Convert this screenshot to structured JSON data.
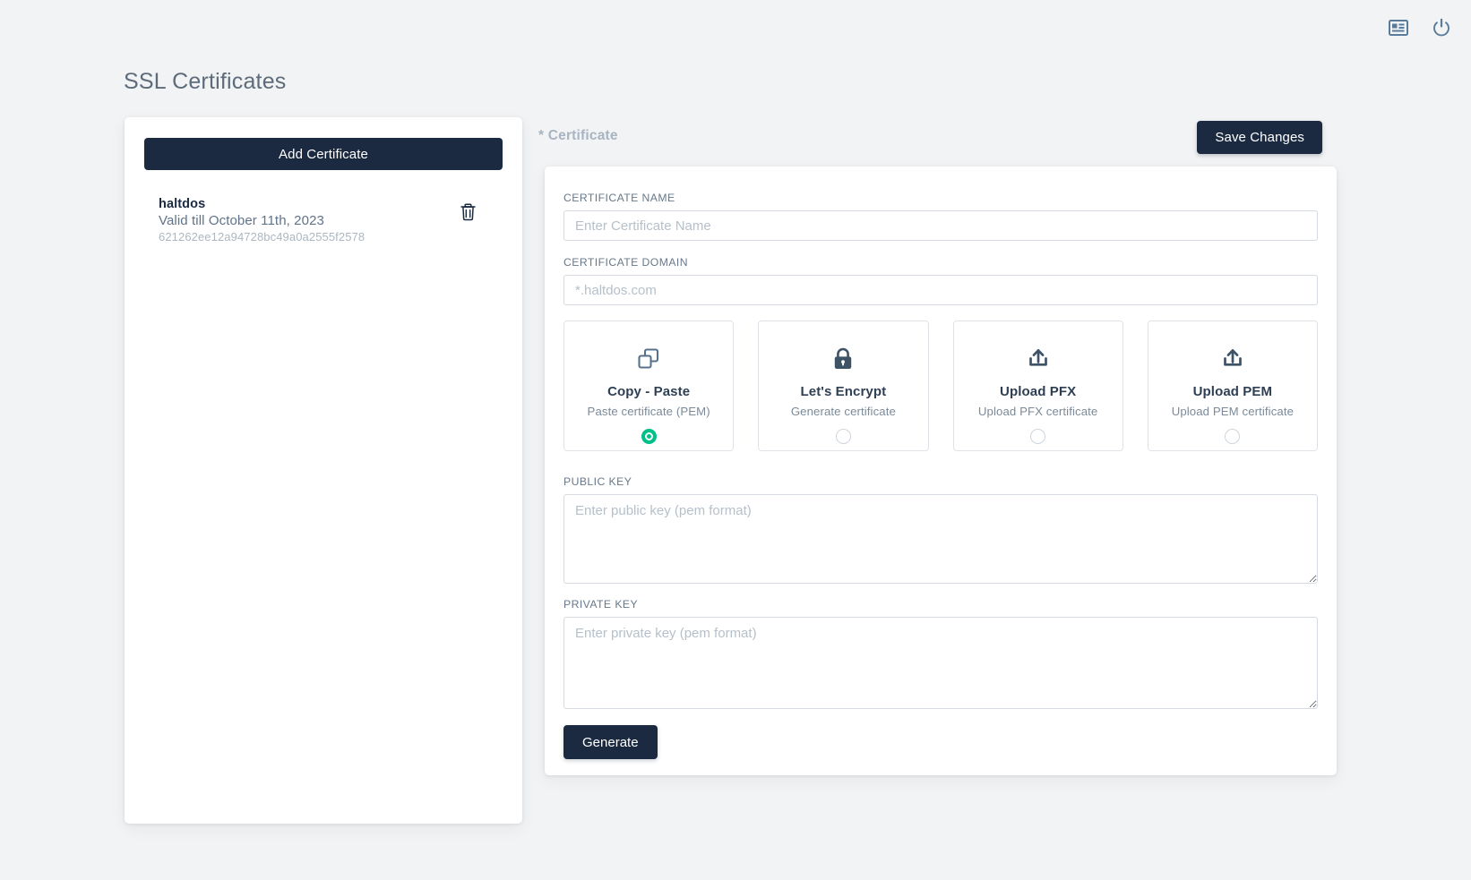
{
  "topbar": {
    "icons": [
      {
        "name": "id-card-icon",
        "label": "Account card"
      },
      {
        "name": "power-icon",
        "label": "Logout"
      }
    ]
  },
  "page": {
    "title": "SSL Certificates"
  },
  "sidebar": {
    "add_button_label": "Add Certificate",
    "certificates": [
      {
        "name": "haltdos",
        "validity": "Valid till October 11th, 2023",
        "id": "621262ee12a94728bc49a0a2555f2578",
        "delete_icon": "trash-icon"
      }
    ]
  },
  "form": {
    "section_label": "* Certificate",
    "save_label": "Save Changes",
    "certificate_name": {
      "label": "CERTIFICATE NAME",
      "value": "",
      "placeholder": "Enter Certificate Name"
    },
    "certificate_domain": {
      "label": "CERTIFICATE DOMAIN",
      "value": "",
      "placeholder": "*.haltdos.com"
    },
    "options": [
      {
        "title": "Copy - Paste",
        "subtitle": "Paste certificate (PEM)",
        "icon": "copy-paste-icon",
        "selected": true
      },
      {
        "title": "Let's Encrypt",
        "subtitle": "Generate certificate",
        "icon": "lock-icon",
        "selected": false
      },
      {
        "title": "Upload PFX",
        "subtitle": "Upload PFX certificate",
        "icon": "upload-icon",
        "selected": false
      },
      {
        "title": "Upload PEM",
        "subtitle": "Upload PEM certificate",
        "icon": "upload-icon",
        "selected": false
      }
    ],
    "public_key": {
      "label": "PUBLIC KEY",
      "value": "",
      "placeholder": "Enter public key (pem format)"
    },
    "private_key": {
      "label": "PRIVATE KEY",
      "value": "",
      "placeholder": "Enter private key (pem format)"
    },
    "generate_label": "Generate"
  },
  "colors": {
    "page_background": "#f2f3f4",
    "primary_dark": "#1b2a41",
    "accent_green": "#00c089",
    "muted_text": "#7b8a99",
    "icon_blue": "#57728c"
  }
}
